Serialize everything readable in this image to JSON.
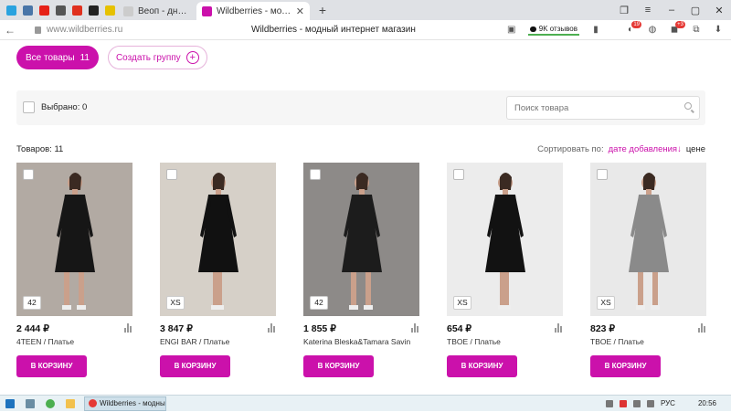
{
  "browser": {
    "pinned_tabs": [
      {
        "name": "telegram-icon",
        "color": "#2aa3df"
      },
      {
        "name": "vk-icon",
        "color": "#4a76a8"
      },
      {
        "name": "youtube-icon",
        "color": "#e62117"
      },
      {
        "name": "yandex-icon",
        "color": "#555555"
      },
      {
        "name": "acrobat-icon",
        "color": "#e0301e"
      },
      {
        "name": "notion-icon",
        "color": "#222222"
      },
      {
        "name": "ukraine-icon",
        "color": "#e6c100"
      }
    ],
    "tabs": [
      {
        "title": "Веоп - дневники",
        "favicon": "#cccccc",
        "active": false
      },
      {
        "title": "Wildberries - модный и",
        "favicon": "#cb11ab",
        "active": true
      }
    ],
    "new_tab_label": "+",
    "url": "www.wildberries.ru",
    "page_title": "Wildberries - модный интернет магазин",
    "reviews_label": "9K отзывов",
    "badges": [
      "19",
      "+3"
    ]
  },
  "toolbar": {
    "all_items_label": "Все товары",
    "all_items_count": "11",
    "create_group_label": "Создать группу",
    "create_group_icon": "+"
  },
  "selection": {
    "label": "Выбрано: 0",
    "search_placeholder": "Поиск товара"
  },
  "list": {
    "count_label": "Товаров: 11",
    "sort_prefix": "Сортировать по:",
    "sort_active": "дате добавления",
    "sort_arrow": "↓",
    "sort_other": "цене"
  },
  "products": [
    {
      "price": "2 444 ₽",
      "brand": "4TEEN / Платье",
      "size": "42",
      "cart_label": "В КОРЗИНУ",
      "bg": "#b2aaa3",
      "dress": "#161616"
    },
    {
      "price": "3 847 ₽",
      "brand": "ENGI BAR / Платье",
      "size": "XS",
      "cart_label": "В КОРЗИНУ",
      "bg": "#d6d0c8",
      "dress": "#111111"
    },
    {
      "price": "1 855 ₽",
      "brand": "Katerina Bleska&Tamara Savin",
      "size": "42",
      "cart_label": "В КОРЗИНУ",
      "bg": "#8d8a88",
      "dress": "#1c1c1c"
    },
    {
      "price": "654 ₽",
      "brand": "TBOE / Платье",
      "size": "XS",
      "cart_label": "В КОРЗИНУ",
      "bg": "#ececec",
      "dress": "#121212"
    },
    {
      "price": "823 ₽",
      "brand": "TBOE / Платье",
      "size": "XS",
      "cart_label": "В КОРЗИНУ",
      "bg": "#e9e9e9",
      "dress": "#8a8a8a"
    }
  ],
  "taskbar": {
    "app_label": "Wildberries - модны...",
    "lang": "РУС",
    "time": "20:56"
  }
}
